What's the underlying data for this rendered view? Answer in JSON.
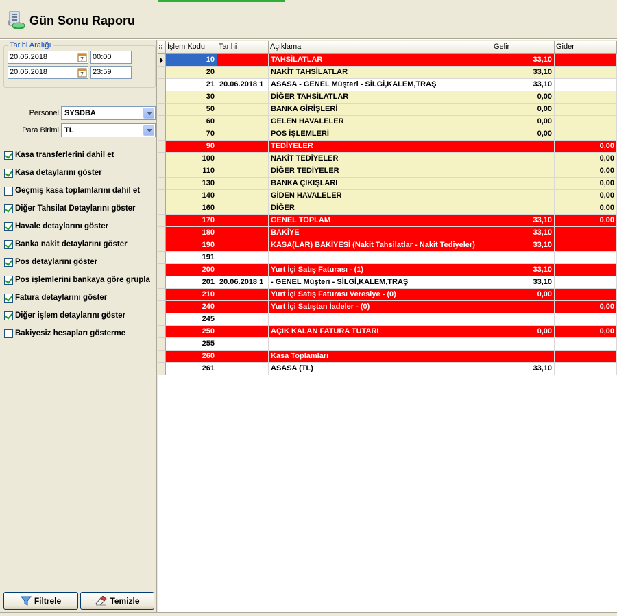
{
  "header": {
    "title": "Gün Sonu Raporu"
  },
  "filters": {
    "date_range_label": "Tarihi Aralığı",
    "start_date": "20.06.2018",
    "start_time": "00:00",
    "end_date": "20.06.2018",
    "end_time": "23:59",
    "personel_label": "Personel",
    "personel_value": "SYSDBA",
    "currency_label": "Para Birimi",
    "currency_value": "TL"
  },
  "checkboxes": [
    {
      "label": "Kasa transferlerini dahil et",
      "checked": true
    },
    {
      "label": "Kasa detaylarını göster",
      "checked": true
    },
    {
      "label": "Geçmiş kasa toplamlarını dahil et",
      "checked": false
    },
    {
      "label": "Diğer Tahsilat Detaylarını göster",
      "checked": true
    },
    {
      "label": "Havale detaylarını göster",
      "checked": true
    },
    {
      "label": "Banka nakit detaylarını göster",
      "checked": true
    },
    {
      "label": "Pos detaylarını göster",
      "checked": true
    },
    {
      "label": "Pos işlemlerini bankaya göre grupla",
      "checked": true
    },
    {
      "label": "Fatura detaylarını göster",
      "checked": true
    },
    {
      "label": "Diğer işlem detaylarını göster",
      "checked": true
    },
    {
      "label": "Bakiyesiz hesapları gösterme",
      "checked": false
    }
  ],
  "buttons": {
    "filter": "Filtrele",
    "clear": "Temizle"
  },
  "grid": {
    "columns": [
      "İşlem Kodu",
      "Tarihi",
      "Açıklama",
      "Gelir",
      "Gider"
    ],
    "rows": [
      {
        "code": "10",
        "date": "",
        "desc": "TAHSİLATLAR",
        "income": "33,10",
        "expense": "",
        "style": "red"
      },
      {
        "code": "20",
        "date": "",
        "desc": "NAKİT TAHSİLATLAR",
        "income": "33,10",
        "expense": "",
        "style": "yellow"
      },
      {
        "code": "21",
        "date": "20.06.2018 1",
        "desc": "ASASA - GENEL Müşteri - SİLGİ,KALEM,TRAŞ",
        "income": "33,10",
        "expense": "",
        "style": "white"
      },
      {
        "code": "30",
        "date": "",
        "desc": "DİĞER TAHSİLATLAR",
        "income": "0,00",
        "expense": "",
        "style": "yellow"
      },
      {
        "code": "50",
        "date": "",
        "desc": "BANKA GİRİŞLERİ",
        "income": "0,00",
        "expense": "",
        "style": "yellow"
      },
      {
        "code": "60",
        "date": "",
        "desc": "GELEN HAVALELER",
        "income": "0,00",
        "expense": "",
        "style": "yellow"
      },
      {
        "code": "70",
        "date": "",
        "desc": "POS İŞLEMLERİ",
        "income": "0,00",
        "expense": "",
        "style": "yellow"
      },
      {
        "code": "90",
        "date": "",
        "desc": "TEDİYELER",
        "income": "",
        "expense": "0,00",
        "style": "red"
      },
      {
        "code": "100",
        "date": "",
        "desc": "NAKİT TEDİYELER",
        "income": "",
        "expense": "0,00",
        "style": "yellow"
      },
      {
        "code": "110",
        "date": "",
        "desc": "DİĞER TEDİYELER",
        "income": "",
        "expense": "0,00",
        "style": "yellow"
      },
      {
        "code": "130",
        "date": "",
        "desc": "BANKA ÇIKIŞLARI",
        "income": "",
        "expense": "0,00",
        "style": "yellow"
      },
      {
        "code": "140",
        "date": "",
        "desc": "GİDEN HAVALELER",
        "income": "",
        "expense": "0,00",
        "style": "yellow"
      },
      {
        "code": "160",
        "date": "",
        "desc": "DİĞER",
        "income": "",
        "expense": "0,00",
        "style": "yellow"
      },
      {
        "code": "170",
        "date": "",
        "desc": "GENEL TOPLAM",
        "income": "33,10",
        "expense": "0,00",
        "style": "red"
      },
      {
        "code": "180",
        "date": "",
        "desc": "BAKİYE",
        "income": "33,10",
        "expense": "",
        "style": "red"
      },
      {
        "code": "190",
        "date": "",
        "desc": "KASA(LAR) BAKİYESİ (Nakit Tahsilatlar - Nakit Tediyeler)",
        "income": "33,10",
        "expense": "",
        "style": "red"
      },
      {
        "code": "191",
        "date": "",
        "desc": "",
        "income": "",
        "expense": "",
        "style": "white"
      },
      {
        "code": "200",
        "date": "",
        "desc": "Yurt İçi Satış Faturası - (1)",
        "income": "33,10",
        "expense": "",
        "style": "red"
      },
      {
        "code": "201",
        "date": "20.06.2018 1",
        "desc": "- GENEL Müşteri - SİLGİ,KALEM,TRAŞ",
        "income": "33,10",
        "expense": "",
        "style": "white"
      },
      {
        "code": "210",
        "date": "",
        "desc": "Yurt İçi Satış Faturası Veresiye - (0)",
        "income": "0,00",
        "expense": "",
        "style": "red"
      },
      {
        "code": "240",
        "date": "",
        "desc": "Yurt İçi Satıştan İadeler - (0)",
        "income": "",
        "expense": "0,00",
        "style": "red"
      },
      {
        "code": "245",
        "date": "",
        "desc": "",
        "income": "",
        "expense": "",
        "style": "white"
      },
      {
        "code": "250",
        "date": "",
        "desc": "AÇIK KALAN FATURA TUTARI",
        "income": "0,00",
        "expense": "0,00",
        "style": "red"
      },
      {
        "code": "255",
        "date": "",
        "desc": "",
        "income": "",
        "expense": "",
        "style": "white"
      },
      {
        "code": "260",
        "date": "",
        "desc": "Kasa Toplamları",
        "income": "",
        "expense": "",
        "style": "red"
      },
      {
        "code": "261",
        "date": "",
        "desc": "ASASA (TL)",
        "income": "33,10",
        "expense": "",
        "style": "white"
      }
    ]
  },
  "colors": {
    "header_row_red": "#ff0000",
    "section_yellow": "#f5f3c4",
    "selection_blue": "#316ac5"
  }
}
